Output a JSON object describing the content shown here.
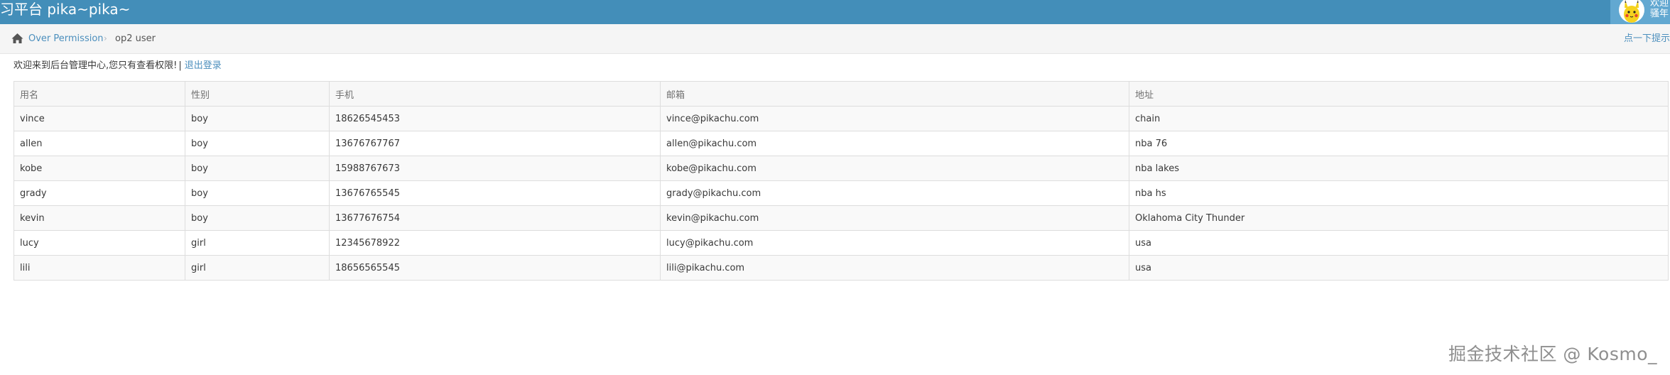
{
  "header": {
    "brand": "习平台 pika~pika~",
    "user_line1": "欢迎",
    "user_line2": "骚年"
  },
  "breadcrumb": {
    "home_icon": "home-icon",
    "link": "Over Permission",
    "separator": "›",
    "current": "op2 user",
    "hint": "点一下提示"
  },
  "welcome": {
    "text": "欢迎来到后台管理中心,您只有查看权限!",
    "separator": "|",
    "logout": "退出登录"
  },
  "table": {
    "headers": [
      "用名",
      "性别",
      "手机",
      "邮箱",
      "地址"
    ],
    "rows": [
      [
        "vince",
        "boy",
        "18626545453",
        "vince@pikachu.com",
        "chain"
      ],
      [
        "allen",
        "boy",
        "13676767767",
        "allen@pikachu.com",
        "nba 76"
      ],
      [
        "kobe",
        "boy",
        "15988767673",
        "kobe@pikachu.com",
        "nba lakes"
      ],
      [
        "grady",
        "boy",
        "13676765545",
        "grady@pikachu.com",
        "nba hs"
      ],
      [
        "kevin",
        "boy",
        "13677676754",
        "kevin@pikachu.com",
        "Oklahoma City Thunder"
      ],
      [
        "lucy",
        "girl",
        "12345678922",
        "lucy@pikachu.com",
        "usa"
      ],
      [
        "lili",
        "girl",
        "18656565545",
        "lili@pikachu.com",
        "usa"
      ]
    ]
  },
  "watermark": "掘金技术社区 @ Kosmo_",
  "colors": {
    "header_bg": "#438eb9",
    "link": "#4c8fbd",
    "breadcrumb_bg": "#f5f5f5"
  }
}
